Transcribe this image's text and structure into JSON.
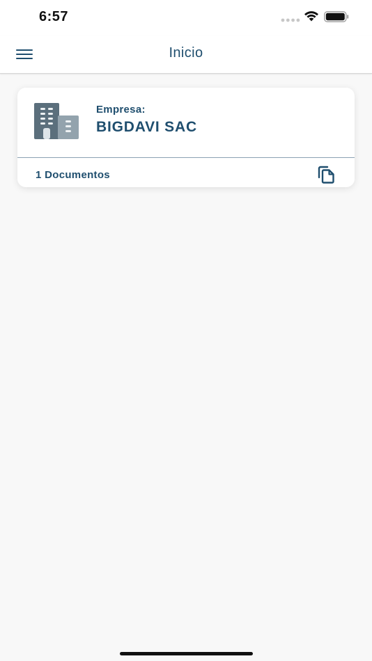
{
  "status_bar": {
    "time": "6:57"
  },
  "nav": {
    "title": "Inicio",
    "menu_icon": "hamburger-menu-icon"
  },
  "company_card": {
    "label": "Empresa:",
    "name": "BIGDAVI SAC",
    "documents": "1 Documentos",
    "icon": "building-icon",
    "action_icon": "copy-documents-icon"
  },
  "colors": {
    "primary": "#1f4e6e",
    "background": "#f8f8f8",
    "card": "#ffffff",
    "divider": "#8aa1b3"
  }
}
